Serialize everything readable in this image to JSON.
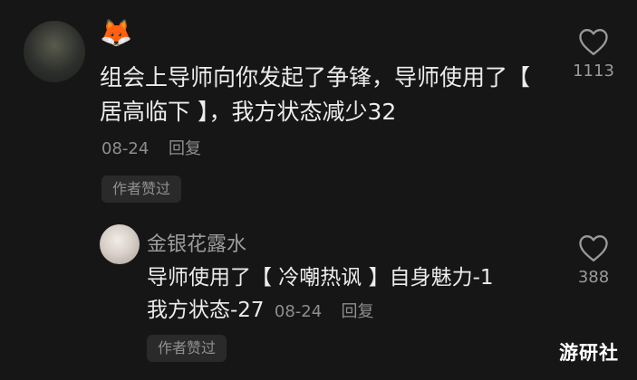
{
  "comment": {
    "fox_emoji": "🦊",
    "text": "组会上导师向你发起了争锋，导师使用了【 居高临下 】，我方状态减少32",
    "date": "08-24",
    "reply_label": "回复",
    "author_badge": "作者赞过",
    "like_count": "1113"
  },
  "reply": {
    "username": "金银花露水",
    "line1": "导师使用了【 冷嘲热讽 】自身魅力-1",
    "line2": "我方状态-27",
    "date": "08-24",
    "reply_label": "回复",
    "author_badge": "作者赞过",
    "like_count": "388"
  },
  "watermark": "游研社"
}
